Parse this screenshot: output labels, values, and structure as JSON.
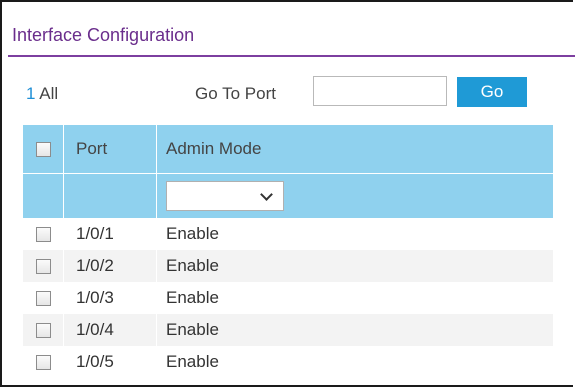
{
  "title": "Interface Configuration",
  "pager": {
    "page": "1",
    "all": "All"
  },
  "goto": {
    "label": "Go To Port",
    "value": "",
    "button": "Go"
  },
  "table": {
    "columns": [
      "Port",
      "Admin Mode"
    ],
    "filter": {
      "admin_mode": ""
    },
    "rows": [
      {
        "port": "1/0/1",
        "admin_mode": "Enable"
      },
      {
        "port": "1/0/2",
        "admin_mode": "Enable"
      },
      {
        "port": "1/0/3",
        "admin_mode": "Enable"
      },
      {
        "port": "1/0/4",
        "admin_mode": "Enable"
      },
      {
        "port": "1/0/5",
        "admin_mode": "Enable"
      }
    ]
  },
  "colors": {
    "title": "#6a2d8c",
    "header_bg": "#8fd1ee",
    "go_button": "#1f9ad6",
    "link": "#1f8fd6"
  }
}
